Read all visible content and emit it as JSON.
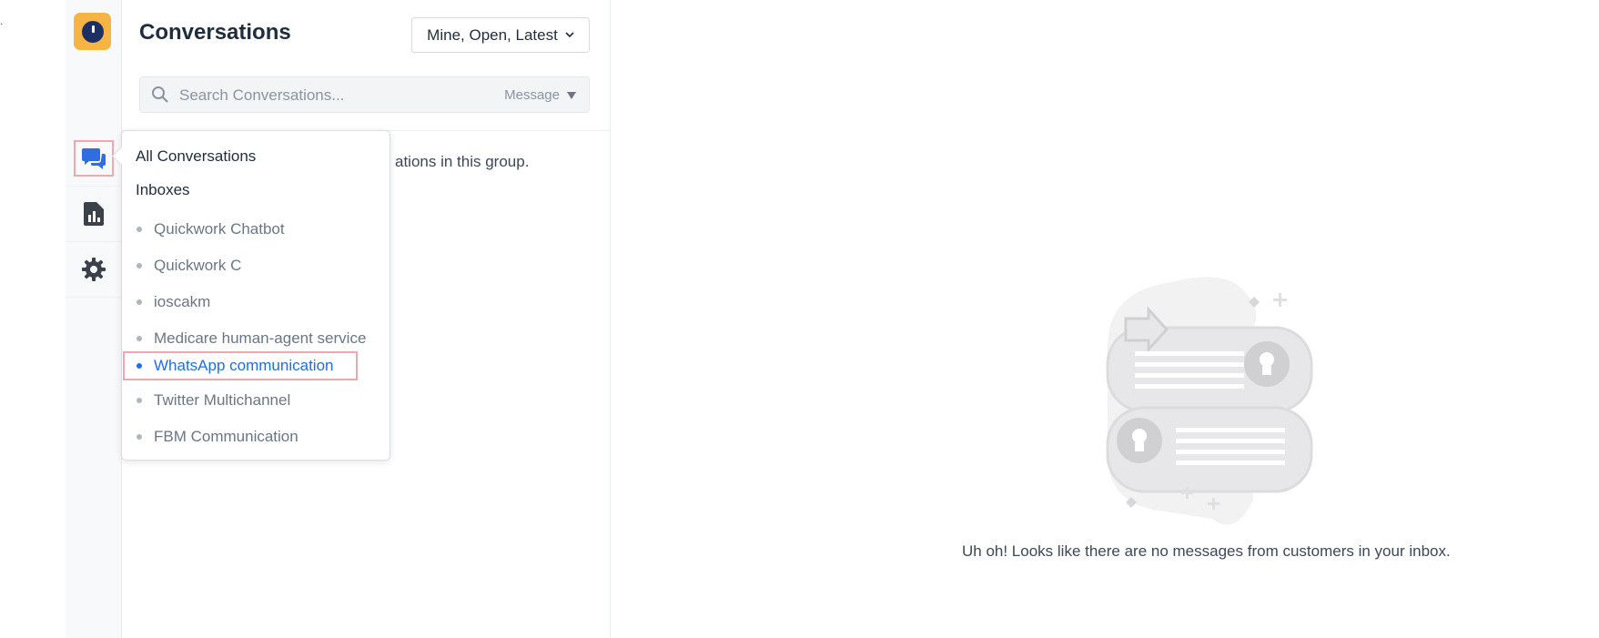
{
  "stray_mark": ".",
  "sidebar": {
    "logo_icon": "chatwoot-logo-icon",
    "items": [
      {
        "name": "conversations",
        "icon": "chat-bubbles-icon",
        "active": true
      },
      {
        "name": "reports",
        "icon": "report-chart-icon",
        "active": false
      },
      {
        "name": "settings",
        "icon": "gear-icon",
        "active": false
      }
    ]
  },
  "conversations": {
    "title": "Conversations",
    "filter_label": "Mine, Open, Latest",
    "search": {
      "placeholder": "Search Conversations...",
      "type_label": "Message"
    },
    "empty_group_text": "ations in this group."
  },
  "popover": {
    "all_label": "All Conversations",
    "inboxes_label": "Inboxes",
    "inboxes": [
      {
        "label": "Quickwork Chatbot",
        "active": false
      },
      {
        "label": "Quickwork C",
        "active": false
      },
      {
        "label": "ioscakm",
        "active": false
      },
      {
        "label": "Medicare human-agent service",
        "active": false
      },
      {
        "label": "WhatsApp communication",
        "active": true
      },
      {
        "label": "Twitter Multichannel",
        "active": false
      },
      {
        "label": "FBM Communication",
        "active": false
      }
    ]
  },
  "main": {
    "empty_message": "Uh oh! Looks like there are no messages from customers in your inbox."
  },
  "colors": {
    "accent": "#1f6fe5",
    "highlight_border": "#f2a7ae",
    "logo_bg": "#f5b443"
  }
}
